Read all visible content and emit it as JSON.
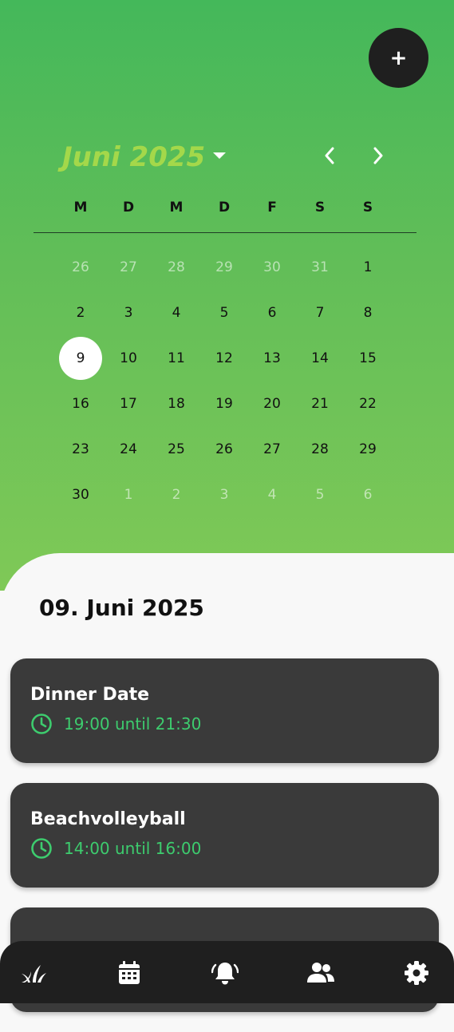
{
  "fab": {
    "label": "+"
  },
  "calendar": {
    "month_title": "Juni 2025",
    "weekdays": [
      "M",
      "D",
      "M",
      "D",
      "F",
      "S",
      "S"
    ],
    "weeks": [
      [
        "26",
        "27",
        "28",
        "29",
        "30",
        "31",
        "1"
      ],
      [
        "2",
        "3",
        "4",
        "5",
        "6",
        "7",
        "8"
      ],
      [
        "9",
        "10",
        "11",
        "12",
        "13",
        "14",
        "15"
      ],
      [
        "16",
        "17",
        "18",
        "19",
        "20",
        "21",
        "22"
      ],
      [
        "23",
        "24",
        "25",
        "26",
        "27",
        "28",
        "29"
      ],
      [
        "30",
        "1",
        "2",
        "3",
        "4",
        "5",
        "6"
      ]
    ],
    "selected": "9"
  },
  "selected_date": "09. Juni 2025",
  "events": [
    {
      "title": "Dinner Date",
      "time": "19:00 until 21:30"
    },
    {
      "title": "Beachvolleyball",
      "time": "14:00 until 16:00"
    },
    {
      "title": "",
      "time": ""
    }
  ],
  "bottom_nav": [
    {
      "icon": "plant-icon"
    },
    {
      "icon": "calendar-icon"
    },
    {
      "icon": "bell-icon"
    },
    {
      "icon": "people-icon"
    },
    {
      "icon": "gear-icon"
    }
  ],
  "colors": {
    "gradient_top": "#44b85a",
    "gradient_bottom": "#7fc957",
    "month_title": "#a4d84a",
    "time_accent": "#3dcc6e",
    "card": "#3a3a3a",
    "dark": "#1f1f1f"
  }
}
